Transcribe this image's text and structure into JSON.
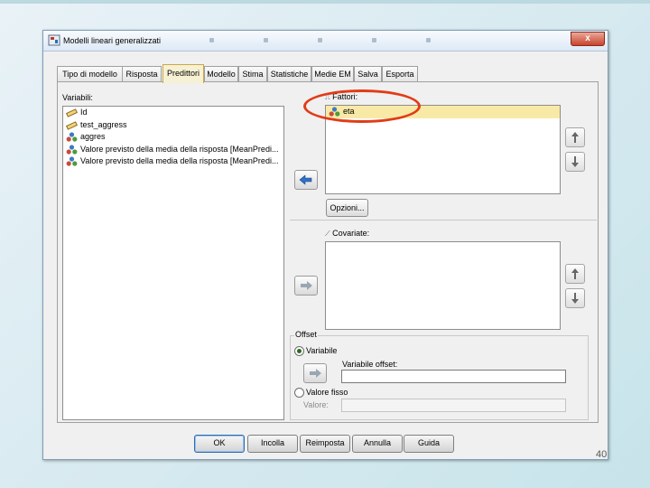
{
  "window": {
    "title": "Modelli lineari generalizzati",
    "close_label": "x"
  },
  "tabs": [
    {
      "label": "Tipo di modello",
      "active": false
    },
    {
      "label": "Risposta",
      "active": false
    },
    {
      "label": "Predittori",
      "active": true
    },
    {
      "label": "Modello",
      "active": false
    },
    {
      "label": "Stima",
      "active": false
    },
    {
      "label": "Statistiche",
      "active": false
    },
    {
      "label": "Medie EM",
      "active": false
    },
    {
      "label": "Salva",
      "active": false
    },
    {
      "label": "Esporta",
      "active": false
    }
  ],
  "variables": {
    "label": "Variabili:",
    "items": [
      {
        "label": "Id",
        "icon": "scale-ruler-icon"
      },
      {
        "label": "test_aggress",
        "icon": "scale-ruler-icon"
      },
      {
        "label": "aggres",
        "icon": "nominal-icon"
      },
      {
        "label": "Valore previsto della media della risposta [MeanPredi...",
        "icon": "nominal-icon"
      },
      {
        "label": "Valore previsto della media della risposta [MeanPredi...",
        "icon": "nominal-icon"
      }
    ]
  },
  "factors": {
    "label": "Fattori:",
    "items": [
      {
        "label": "eta",
        "icon": "nominal-icon",
        "selected": true
      }
    ],
    "options_button": "Opzioni..."
  },
  "covariates": {
    "label": "Covariate:",
    "items": []
  },
  "offset": {
    "group_label": "Offset",
    "variable_option": "Variabile",
    "variable_field_label": "Variabile offset:",
    "variable_value": "",
    "fixed_option": "Valore fisso",
    "fixed_field_label": "Valore:",
    "fixed_value": "",
    "selected": "variable"
  },
  "buttons": {
    "ok": "OK",
    "paste": "Incolla",
    "reset": "Reimposta",
    "cancel": "Annulla",
    "help": "Guida"
  },
  "slide_number": "40",
  "colors": {
    "highlight_ellipse": "#e23b17",
    "active_tab": "#f7f1d4",
    "selected_row": "#f8eaa6"
  }
}
